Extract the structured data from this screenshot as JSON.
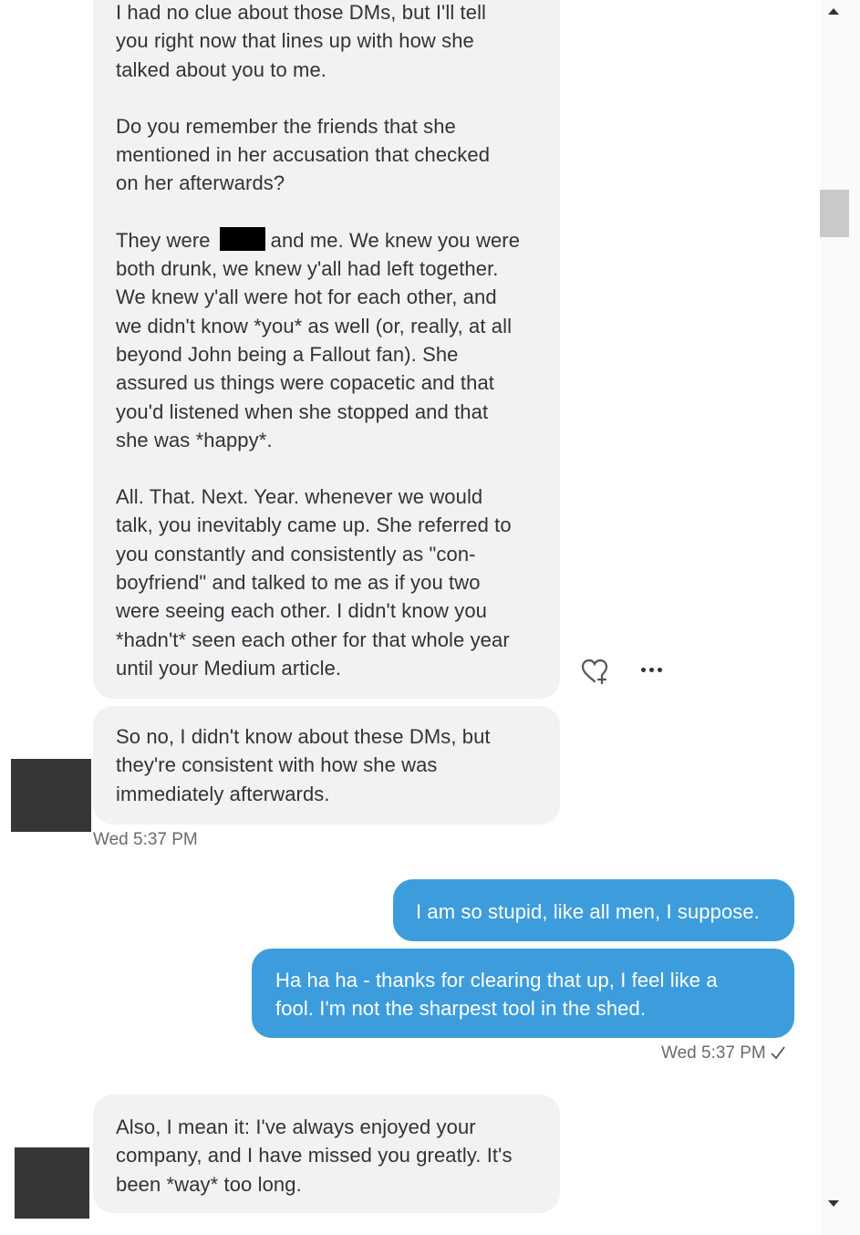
{
  "messages": {
    "incoming_1": {
      "p1": "I had no clue about those DMs, but I'll tell\nyou right now that lines up with how she\ntalked about you to me.",
      "p2": "Do you remember the friends that she\nmentioned in her accusation that checked\non her afterwards?",
      "p3_start": "They were",
      "p3_after_redaction": "and me. We knew you were",
      "p3_rest": "both drunk, we knew y'all had left together.\nWe knew y'all were hot for each other, and\nwe didn't know *you* as well (or, really, at all\nbeyond John being a Fallout fan). She\nassured us things were copacetic and that\nyou'd listened when she stopped and that\nshe was *happy*.",
      "p4": "All. That. Next. Year. whenever we would\ntalk, you inevitably came up. She referred to\nyou constantly and consistently as \"con-\nboyfriend\" and talked to me as if you two\nwere seeing each other. I didn't know you\n*hadn't* seen each other for that whole year\nuntil your Medium article."
    },
    "incoming_2": "So no, I didn't know about these DMs, but\nthey're consistent with how she was\nimmediately afterwards.",
    "incoming_time": "Wed 5:37 PM",
    "outgoing_1": "I am so stupid, like all men, I suppose.",
    "outgoing_2": "Ha ha ha - thanks for clearing that up, I feel like a\nfool. I'm not the sharpest tool in the shed.",
    "outgoing_time": "Wed 5:37 PM",
    "incoming_3": "Also, I mean it: I've always enjoyed your\ncompany, and I have missed you greatly. It's\nbeen *way* too long."
  },
  "icons": {
    "react": "heart-add-icon",
    "more": "more-options-icon",
    "read": "checkmark-icon",
    "scroll_up": "scroll-up-arrow-icon",
    "scroll_down": "scroll-down-arrow-icon"
  },
  "colors": {
    "incoming_bubble": "#f1f2f4",
    "outgoing_bubble": "#3d9ddc",
    "avatar_redaction": "#383536"
  }
}
